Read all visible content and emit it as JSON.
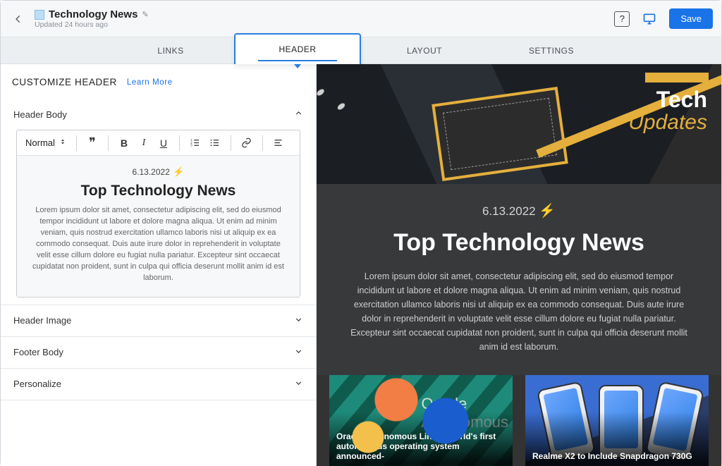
{
  "topbar": {
    "title": "Technology News",
    "updated": "Updated 24 hours ago",
    "save_label": "Save"
  },
  "tabs": {
    "links": "LINKS",
    "header": "HEADER",
    "layout": "LAYOUT",
    "settings": "SETTINGS"
  },
  "leftpanel": {
    "heading": "CUSTOMIZE HEADER",
    "learn_more": "Learn More",
    "sections": {
      "header_body": "Header Body",
      "header_image": "Header Image",
      "footer_body": "Footer Body",
      "personalize": "Personalize"
    },
    "editor": {
      "format_select": "Normal",
      "date": "6.13.2022",
      "title": "Top Technology News",
      "paragraph": "Lorem ipsum dolor sit amet, consectetur adipiscing elit, sed do eiusmod tempor incididunt ut labore et dolore magna aliqua. Ut enim ad minim veniam, quis nostrud exercitation ullamco laboris nisi ut aliquip ex ea commodo consequat. Duis aute irure dolor in reprehenderit in voluptate velit esse cillum dolore eu fugiat nulla pariatur. Excepteur sint occaecat cupidatat non proident, sunt in culpa qui officia deserunt mollit anim id est laborum."
    }
  },
  "preview": {
    "brand_line1": "Tech",
    "brand_line2": "Updates",
    "date": "6.13.2022",
    "title": "Top Technology News",
    "paragraph": "Lorem ipsum dolor sit amet, consectetur adipiscing elit, sed do eiusmod tempor incididunt ut labore et dolore magna aliqua. Ut enim ad minim veniam, quis nostrud exercitation ullamco laboris nisi ut aliquip ex ea commodo consequat. Duis aute irure dolor in reprehenderit in voluptate velit esse cillum dolore eu fugiat nulla pariatur. Excepteur sint occaecat cupidatat non proident, sunt in culpa qui officia deserunt mollit anim id est laborum.",
    "cards": [
      {
        "ghost_top": "Oracle",
        "ghost_bottom": "Autonomous",
        "caption": "Oracle Autonomous Linux: World's first autonomous operating system announced-"
      },
      {
        "caption": "Realme X2 to Include Snapdragon 730G"
      }
    ]
  }
}
